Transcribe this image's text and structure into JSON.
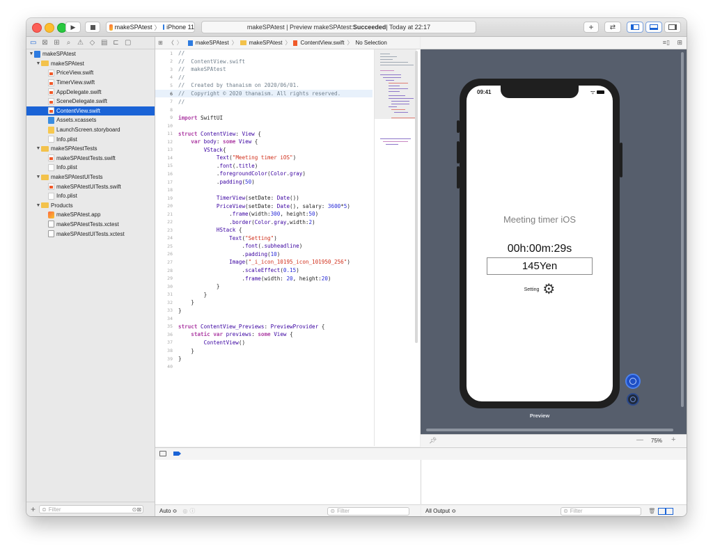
{
  "toolbar": {
    "scheme_name": "makeSPAtest",
    "device_name": "iPhone 11",
    "activity_prefix": "makeSPAtest | Preview makeSPAtest: ",
    "activity_status": "Succeeded",
    "activity_time": " | Today at 22:17"
  },
  "navigator": {
    "items": [
      {
        "label": "makeSPAtest",
        "indent": 0,
        "icon": "proj",
        "disclosure": "▼"
      },
      {
        "label": "makeSPAtest",
        "indent": 1,
        "icon": "folder",
        "disclosure": "▼"
      },
      {
        "label": "PriceView.swift",
        "indent": 2,
        "icon": "swift",
        "disclosure": ""
      },
      {
        "label": "TimerView.swift",
        "indent": 2,
        "icon": "swift",
        "disclosure": ""
      },
      {
        "label": "AppDelegate.swift",
        "indent": 2,
        "icon": "swift",
        "disclosure": ""
      },
      {
        "label": "SceneDelegate.swift",
        "indent": 2,
        "icon": "swift",
        "disclosure": ""
      },
      {
        "label": "ContentView.swift",
        "indent": 2,
        "icon": "swift",
        "disclosure": "",
        "selected": true
      },
      {
        "label": "Assets.xcassets",
        "indent": 2,
        "icon": "assets",
        "disclosure": ""
      },
      {
        "label": "LaunchScreen.storyboard",
        "indent": 2,
        "icon": "story",
        "disclosure": ""
      },
      {
        "label": "Info.plist",
        "indent": 2,
        "icon": "plist",
        "disclosure": ""
      },
      {
        "label": "makeSPAtestTests",
        "indent": 1,
        "icon": "folder",
        "disclosure": "▼"
      },
      {
        "label": "makeSPAtestTests.swift",
        "indent": 2,
        "icon": "swift",
        "disclosure": ""
      },
      {
        "label": "Info.plist",
        "indent": 2,
        "icon": "plist",
        "disclosure": ""
      },
      {
        "label": "makeSPAtestUITests",
        "indent": 1,
        "icon": "folder",
        "disclosure": "▼"
      },
      {
        "label": "makeSPAtestUITests.swift",
        "indent": 2,
        "icon": "swift",
        "disclosure": ""
      },
      {
        "label": "Info.plist",
        "indent": 2,
        "icon": "plist",
        "disclosure": ""
      },
      {
        "label": "Products",
        "indent": 1,
        "icon": "folder",
        "disclosure": "▼"
      },
      {
        "label": "makeSPAtest.app",
        "indent": 2,
        "icon": "app",
        "disclosure": ""
      },
      {
        "label": "makeSPAtestTests.xctest",
        "indent": 2,
        "icon": "xctest",
        "disclosure": ""
      },
      {
        "label": "makeSPAtestUITests.xctest",
        "indent": 2,
        "icon": "xctest",
        "disclosure": ""
      }
    ],
    "filter_placeholder": "Filter"
  },
  "jumpbar": {
    "project": "makeSPAtest",
    "group": "makeSPAtest",
    "file": "ContentView.swift",
    "selection": "No Selection"
  },
  "editor": {
    "current_line": 6,
    "lines": [
      [
        [
          "c",
          "//"
        ]
      ],
      [
        [
          "c",
          "//  ContentView.swift"
        ]
      ],
      [
        [
          "c",
          "//  makeSPAtest"
        ]
      ],
      [
        [
          "c",
          "//"
        ]
      ],
      [
        [
          "c",
          "//  Created by thanaism on 2020/06/01."
        ]
      ],
      [
        [
          "c",
          "//  Copyright © 2020 thanaism. All rights reserved."
        ]
      ],
      [
        [
          "c",
          "//"
        ]
      ],
      [],
      [
        [
          "k",
          "import"
        ],
        [
          "p",
          " SwiftUI"
        ]
      ],
      [],
      [
        [
          "k",
          "struct"
        ],
        [
          "p",
          " "
        ],
        [
          "t",
          "ContentView"
        ],
        [
          "p",
          ": "
        ],
        [
          "t",
          "View"
        ],
        [
          "p",
          " {"
        ]
      ],
      [
        [
          "p",
          "    "
        ],
        [
          "k",
          "var"
        ],
        [
          "p",
          " "
        ],
        [
          "t",
          "body"
        ],
        [
          "p",
          ": "
        ],
        [
          "k",
          "some"
        ],
        [
          "p",
          " "
        ],
        [
          "t",
          "View"
        ],
        [
          "p",
          " {"
        ]
      ],
      [
        [
          "p",
          "        "
        ],
        [
          "t",
          "VStack"
        ],
        [
          "p",
          "{"
        ]
      ],
      [
        [
          "p",
          "            "
        ],
        [
          "t",
          "Text"
        ],
        [
          "p",
          "("
        ],
        [
          "s",
          "\"Meeting timer iOS\""
        ],
        [
          "p",
          ")"
        ]
      ],
      [
        [
          "p",
          "            ."
        ],
        [
          "t",
          "font"
        ],
        [
          "p",
          "(."
        ],
        [
          "t",
          "title"
        ],
        [
          "p",
          ")"
        ]
      ],
      [
        [
          "p",
          "            ."
        ],
        [
          "t",
          "foregroundColor"
        ],
        [
          "p",
          "("
        ],
        [
          "t",
          "Color"
        ],
        [
          "p",
          "."
        ],
        [
          "t",
          "gray"
        ],
        [
          "p",
          ")"
        ]
      ],
      [
        [
          "p",
          "            ."
        ],
        [
          "t",
          "padding"
        ],
        [
          "p",
          "("
        ],
        [
          "n",
          "50"
        ],
        [
          "p",
          ")"
        ]
      ],
      [],
      [
        [
          "p",
          "            "
        ],
        [
          "t",
          "TimerView"
        ],
        [
          "p",
          "(setDate: "
        ],
        [
          "t",
          "Date"
        ],
        [
          "p",
          "())"
        ]
      ],
      [
        [
          "p",
          "            "
        ],
        [
          "t",
          "PriceView"
        ],
        [
          "p",
          "(setDate: "
        ],
        [
          "t",
          "Date"
        ],
        [
          "p",
          "(), salary: "
        ],
        [
          "n",
          "3600"
        ],
        [
          "p",
          "*"
        ],
        [
          "n",
          "5"
        ],
        [
          "p",
          ")"
        ]
      ],
      [
        [
          "p",
          "                ."
        ],
        [
          "t",
          "frame"
        ],
        [
          "p",
          "(width:"
        ],
        [
          "n",
          "300"
        ],
        [
          "p",
          ", height:"
        ],
        [
          "n",
          "50"
        ],
        [
          "p",
          ")"
        ]
      ],
      [
        [
          "p",
          "                ."
        ],
        [
          "t",
          "border"
        ],
        [
          "p",
          "("
        ],
        [
          "t",
          "Color"
        ],
        [
          "p",
          "."
        ],
        [
          "t",
          "gray"
        ],
        [
          "p",
          ",width:"
        ],
        [
          "n",
          "2"
        ],
        [
          "p",
          ")"
        ]
      ],
      [
        [
          "p",
          "            "
        ],
        [
          "t",
          "HStack"
        ],
        [
          "p",
          " {"
        ]
      ],
      [
        [
          "p",
          "                "
        ],
        [
          "t",
          "Text"
        ],
        [
          "p",
          "("
        ],
        [
          "s",
          "\"Setting\""
        ],
        [
          "p",
          ")"
        ]
      ],
      [
        [
          "p",
          "                    ."
        ],
        [
          "t",
          "font"
        ],
        [
          "p",
          "(."
        ],
        [
          "t",
          "subheadline"
        ],
        [
          "p",
          ")"
        ]
      ],
      [
        [
          "p",
          "                    ."
        ],
        [
          "t",
          "padding"
        ],
        [
          "p",
          "("
        ],
        [
          "n",
          "10"
        ],
        [
          "p",
          ")"
        ]
      ],
      [
        [
          "p",
          "                "
        ],
        [
          "t",
          "Image"
        ],
        [
          "p",
          "("
        ],
        [
          "s",
          "\"_i_icon_10195_icon_101950_256\""
        ],
        [
          "p",
          ")"
        ]
      ],
      [
        [
          "p",
          "                    ."
        ],
        [
          "t",
          "scaleEffect"
        ],
        [
          "p",
          "("
        ],
        [
          "n",
          "0.15"
        ],
        [
          "p",
          ")"
        ]
      ],
      [
        [
          "p",
          "                    ."
        ],
        [
          "t",
          "frame"
        ],
        [
          "p",
          "(width: "
        ],
        [
          "n",
          "20"
        ],
        [
          "p",
          ", height:"
        ],
        [
          "n",
          "20"
        ],
        [
          "p",
          ")"
        ]
      ],
      [
        [
          "p",
          "            }"
        ]
      ],
      [
        [
          "p",
          "        }"
        ]
      ],
      [
        [
          "p",
          "    }"
        ]
      ],
      [
        [
          "p",
          "}"
        ]
      ],
      [],
      [
        [
          "k",
          "struct"
        ],
        [
          "p",
          " "
        ],
        [
          "t",
          "ContentView_Previews"
        ],
        [
          "p",
          ": "
        ],
        [
          "t",
          "PreviewProvider"
        ],
        [
          "p",
          " {"
        ]
      ],
      [
        [
          "p",
          "    "
        ],
        [
          "k",
          "static"
        ],
        [
          "p",
          " "
        ],
        [
          "k",
          "var"
        ],
        [
          "p",
          " "
        ],
        [
          "t",
          "previews"
        ],
        [
          "p",
          ": "
        ],
        [
          "k",
          "some"
        ],
        [
          "p",
          " "
        ],
        [
          "t",
          "View"
        ],
        [
          "p",
          " {"
        ]
      ],
      [
        [
          "p",
          "        "
        ],
        [
          "t",
          "ContentView"
        ],
        [
          "p",
          "()"
        ]
      ],
      [
        [
          "p",
          "    }"
        ]
      ],
      [
        [
          "p",
          "}"
        ]
      ],
      []
    ]
  },
  "preview": {
    "status_time": "09:41",
    "title": "Meeting timer iOS",
    "timer": "00h:00m:29s",
    "price": "145Yen",
    "setting_label": "Setting",
    "caption": "Preview",
    "zoom": "75%"
  },
  "debug": {
    "variables_scope": "Auto ≎",
    "filter_placeholder": "Filter",
    "output_scope": "All Output ≎"
  },
  "colors": {
    "selection": "#1a63d6",
    "comment": "#707f8c",
    "keyword": "#ad3da4",
    "type": "#3900a0",
    "string": "#d12f1b",
    "number": "#272ad8",
    "canvas": "#565e6c"
  }
}
